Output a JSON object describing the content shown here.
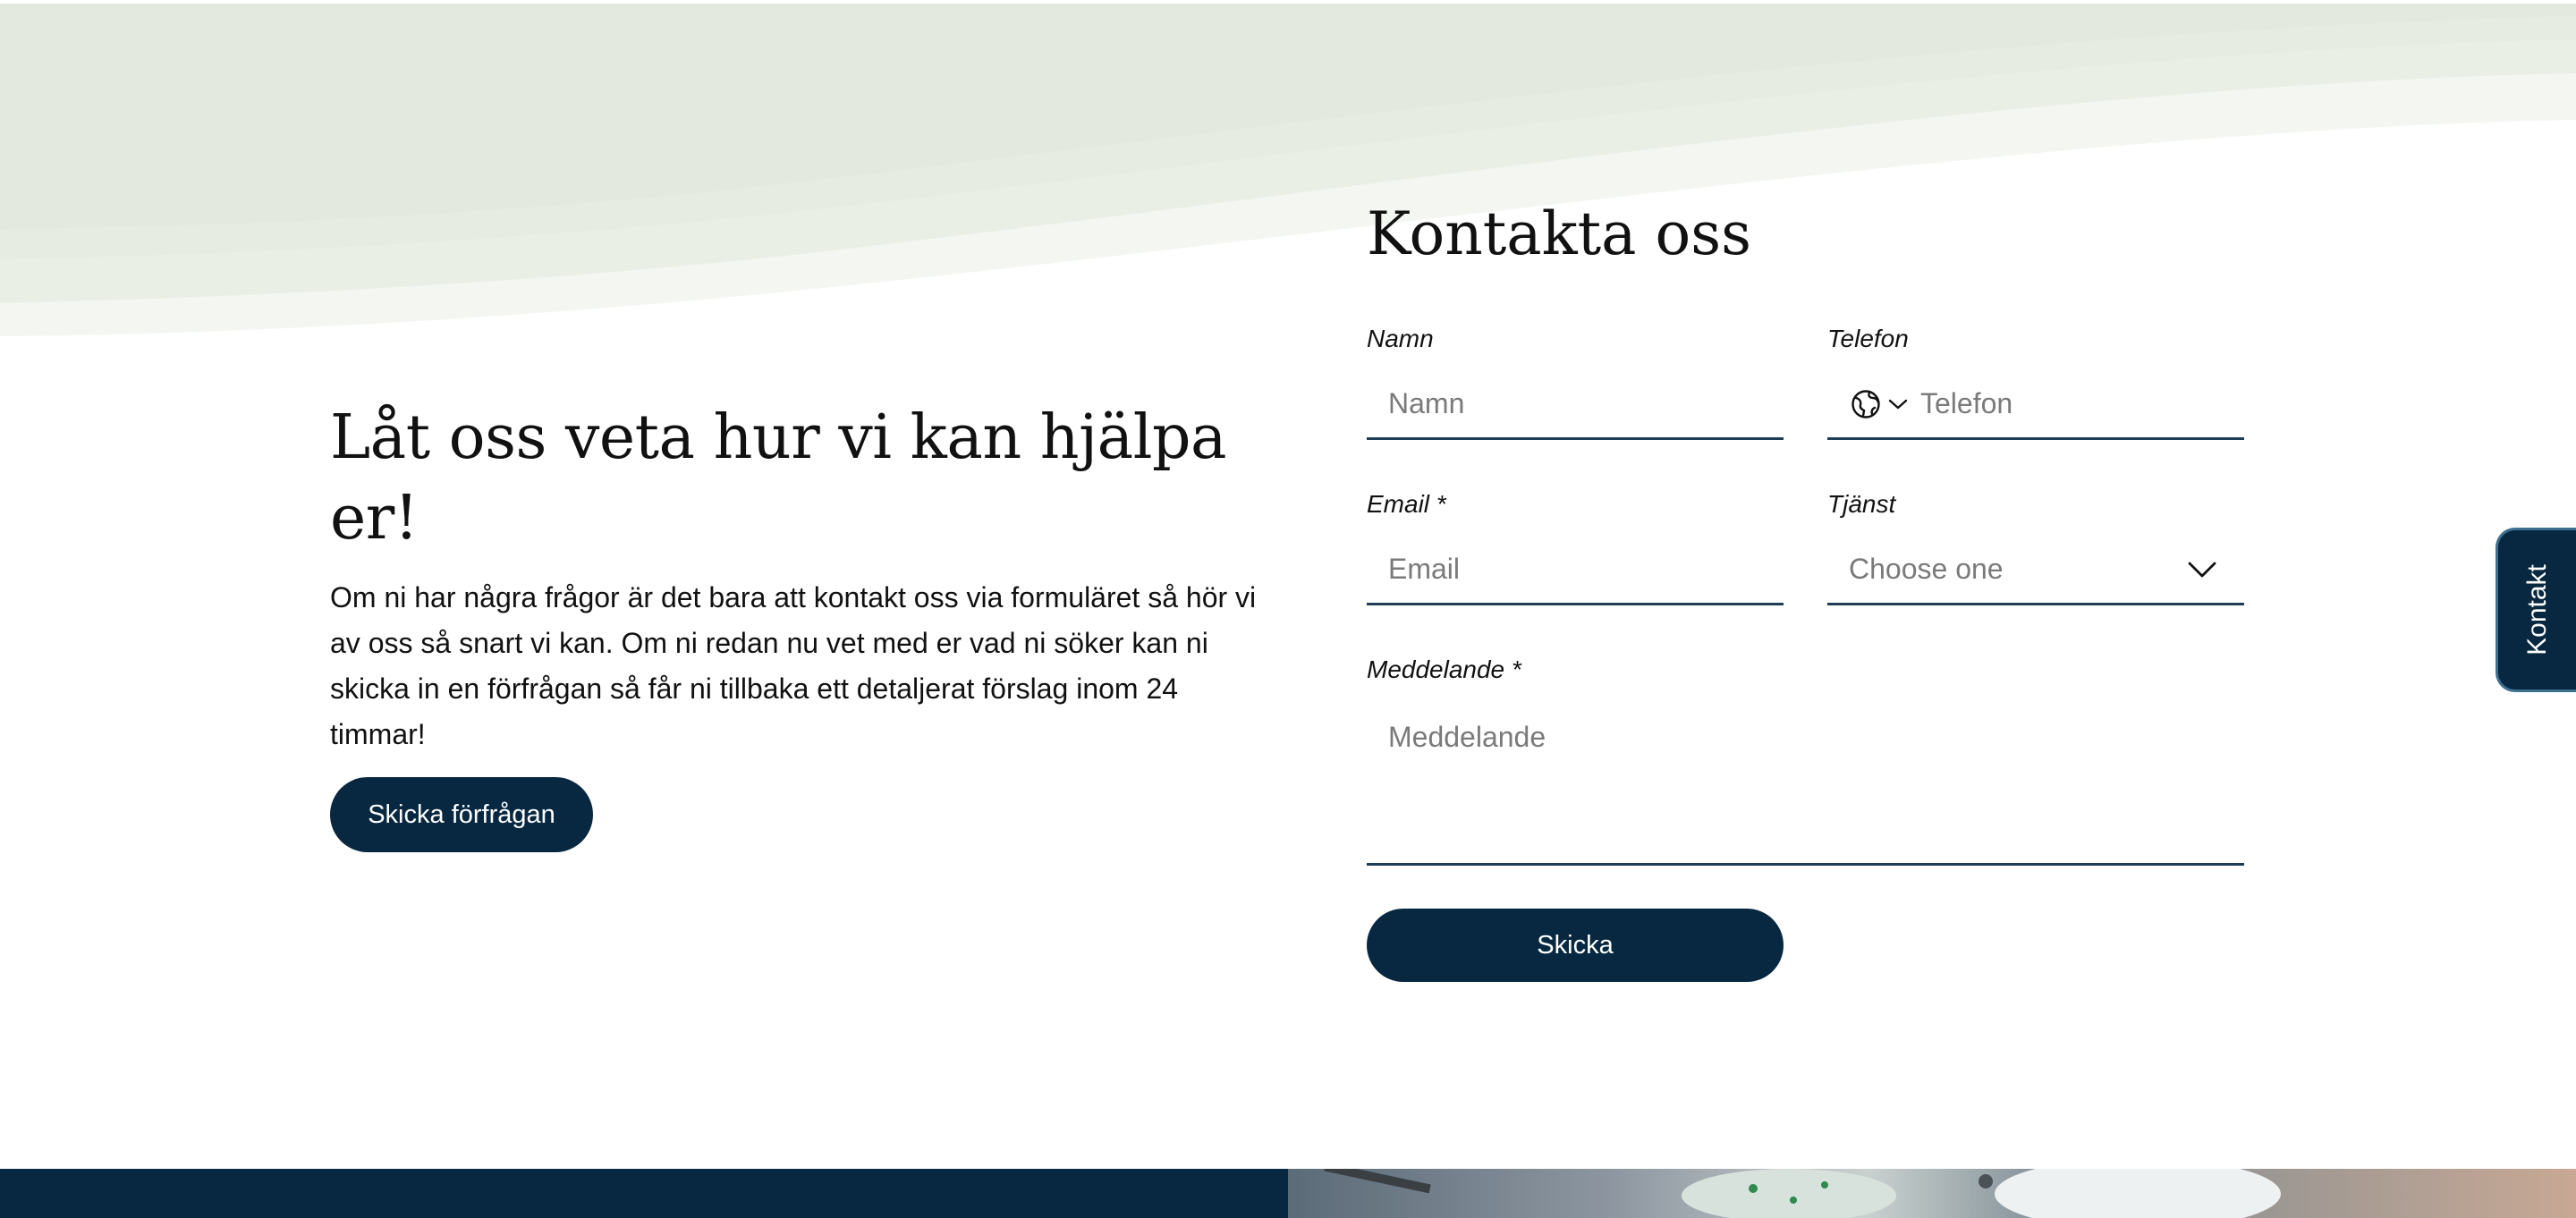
{
  "promo": {
    "heading": "Låt oss veta hur vi kan hjälpa er!",
    "body": "Om ni har några frågor är det bara att kontakt oss via formuläret så hör vi av oss så snart vi kan. Om ni redan nu vet med er vad ni söker kan ni skicka in en förfrågan så får ni tillbaka ett detaljerat förslag inom 24 timmar!",
    "cta_label": "Skicka förfrågan"
  },
  "form": {
    "title": "Kontakta oss",
    "name": {
      "label": "Namn",
      "placeholder": "Namn"
    },
    "phone": {
      "label": "Telefon",
      "placeholder": "Telefon"
    },
    "email": {
      "label": "Email *",
      "placeholder": "Email"
    },
    "service": {
      "label": "Tjänst",
      "value": "Choose one"
    },
    "message": {
      "label": "Meddelande *",
      "placeholder": "Meddelande"
    },
    "submit_label": "Skicka"
  },
  "side_tab": {
    "label": "Kontakt"
  },
  "colors": {
    "primary": "#072840",
    "wave_light": "#e3e9df",
    "field_line": "#1c3d55"
  },
  "icons": {
    "phone_country": "globe-icon",
    "phone_dropdown": "chevron-down-icon",
    "service_dropdown": "chevron-down-icon"
  }
}
